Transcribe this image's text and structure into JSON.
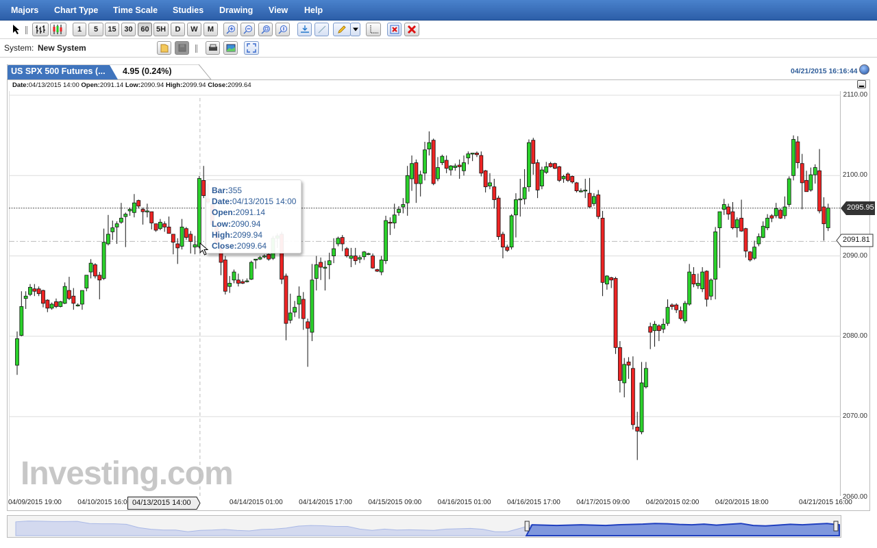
{
  "menu": [
    "Majors",
    "Chart Type",
    "Time Scale",
    "Studies",
    "Drawing",
    "View",
    "Help"
  ],
  "toolbar": {
    "intervals": [
      "1",
      "5",
      "15",
      "30",
      "60",
      "5H",
      "D",
      "W",
      "M"
    ],
    "active_interval": "60"
  },
  "system": {
    "label": "System:",
    "name": "New System"
  },
  "instrument": {
    "tab_label": "US SPX 500 Futures (...",
    "change": "4.95 (0.24%)",
    "timestamp": "04/21/2015 16:16:44"
  },
  "info_line": {
    "date_label": "Date:",
    "date": "04/13/2015 14:00",
    "open_label": "Open:",
    "open": "2091.14",
    "low_label": "Low:",
    "low": "2090.94",
    "high_label": "High:",
    "high": "2099.94",
    "close_label": "Close:",
    "close": "2099.64"
  },
  "tooltip": {
    "bar_label": "Bar:",
    "bar": "355",
    "date_label": "Date:",
    "date": "04/13/2015 14:00",
    "open_label": "Open:",
    "open": "2091.14",
    "low_label": "Low:",
    "low": "2090.94",
    "high_label": "High:",
    "high": "2099.94",
    "close_label": "Close:",
    "close": "2099.64"
  },
  "crosshair_label": "04/13/2015 14:00",
  "watermark": "Investing.com",
  "colors": {
    "up": "#2bd12b",
    "down": "#ee2424",
    "menu": "#2c5ea8",
    "accent": "#2f5d99"
  },
  "chart_data": {
    "type": "candlestick",
    "title": "US SPX 500 Futures",
    "ylim": [
      2060,
      2110
    ],
    "y_ticks": [
      "2110.00",
      "2100.00",
      "2090.00",
      "2080.00",
      "2070.00",
      "2060.00"
    ],
    "y_tick_values": [
      2110,
      2100,
      2090,
      2080,
      2070,
      2060
    ],
    "x_ticks": [
      "04/09/2015 19:00",
      "04/10/2015 16:00",
      "04/14/2015 01:00",
      "04/14/2015 17:00",
      "04/15/2015 09:00",
      "04/16/2015 01:00",
      "04/16/2015 17:00",
      "04/17/2015 09:00",
      "04/20/2015 02:00",
      "04/20/2015 18:00",
      "04/21/2015 16:00"
    ],
    "x_tick_bar_index": [
      0,
      16,
      51,
      67,
      83,
      99,
      115,
      131,
      147,
      163,
      188
    ],
    "last_price": {
      "value": 2095.95,
      "label": "2095.95"
    },
    "ref_price": {
      "value": 2091.81,
      "label": "2091.81"
    },
    "crosshair_bar_index": 42,
    "ohlc": [
      [
        2076.4,
        2080.6,
        2075.2,
        2079.7
      ],
      [
        2080.1,
        2085.6,
        2080.0,
        2083.7
      ],
      [
        2084.7,
        2085.6,
        2083.4,
        2085.0
      ],
      [
        2085.2,
        2086.5,
        2085.0,
        2086.1
      ],
      [
        2085.9,
        2086.5,
        2085.0,
        2085.6
      ],
      [
        2085.9,
        2086.2,
        2085.0,
        2085.3
      ],
      [
        2085.7,
        2085.8,
        2083.6,
        2084.1
      ],
      [
        2084.5,
        2084.6,
        2083.0,
        2083.5
      ],
      [
        2083.5,
        2084.2,
        2083.3,
        2084.0
      ],
      [
        2084.3,
        2084.7,
        2083.5,
        2083.7
      ],
      [
        2083.7,
        2084.4,
        2083.6,
        2084.3
      ],
      [
        2084.1,
        2086.7,
        2084.0,
        2086.2
      ],
      [
        2085.7,
        2087.4,
        2084.5,
        2084.7
      ],
      [
        2085.0,
        2086.0,
        2083.3,
        2084.1
      ],
      [
        2083.9,
        2084.1,
        2083.7,
        2083.9
      ],
      [
        2084.0,
        2085.7,
        2083.3,
        2085.7
      ],
      [
        2086.0,
        2087.6,
        2085.6,
        2087.6
      ],
      [
        2088.0,
        2089.6,
        2087.2,
        2089.1
      ],
      [
        2088.9,
        2089.1,
        2087.2,
        2087.5
      ],
      [
        2087.6,
        2088.0,
        2084.6,
        2087.0
      ],
      [
        2087.2,
        2093.4,
        2087.0,
        2091.7
      ],
      [
        2091.5,
        2095.1,
        2091.3,
        2092.7
      ],
      [
        2093.0,
        2094.4,
        2092.0,
        2093.5
      ],
      [
        2093.6,
        2094.3,
        2091.5,
        2094.0
      ],
      [
        2094.2,
        2096.6,
        2094.0,
        2094.7
      ],
      [
        2094.9,
        2095.4,
        2091.1,
        2095.2
      ],
      [
        2095.6,
        2096.0,
        2095.0,
        2095.8
      ],
      [
        2095.4,
        2097.7,
        2094.8,
        2096.6
      ],
      [
        2096.9,
        2097.0,
        2095.9,
        2096.2
      ],
      [
        2095.8,
        2096.0,
        2093.9,
        2095.5
      ],
      [
        2095.5,
        2096.5,
        2094.8,
        2095.6
      ],
      [
        2095.5,
        2095.5,
        2093.3,
        2094.1
      ],
      [
        2094.0,
        2094.0,
        2093.0,
        2093.2
      ],
      [
        2093.4,
        2094.6,
        2093.2,
        2094.2
      ],
      [
        2094.0,
        2094.3,
        2093.0,
        2093.6
      ],
      [
        2093.6,
        2094.9,
        2092.8,
        2092.8
      ],
      [
        2092.7,
        2092.7,
        2090.2,
        2091.7
      ],
      [
        2091.5,
        2092.2,
        2089.0,
        2091.0
      ],
      [
        2091.2,
        2094.6,
        2090.8,
        2093.6
      ],
      [
        2093.4,
        2093.6,
        2092.0,
        2092.3
      ],
      [
        2092.7,
        2093.1,
        2090.3,
        2091.8
      ],
      [
        2091.1,
        2092.5,
        2090.2,
        2091.4
      ],
      [
        2091.14,
        2099.94,
        2090.94,
        2099.64
      ],
      [
        2099.4,
        2101.2,
        2097.2,
        2097.5
      ],
      [
        2097.1,
        2099.0,
        2096.5,
        2096.7
      ],
      [
        2096.4,
        2096.8,
        2092.9,
        2093.9
      ],
      [
        2093.9,
        2094.2,
        2091.2,
        2091.5
      ],
      [
        2091.2,
        2092.0,
        2087.6,
        2089.2
      ],
      [
        2089.5,
        2090.0,
        2085.2,
        2085.6
      ],
      [
        2086.2,
        2087.5,
        2085.4,
        2086.6
      ],
      [
        2087.0,
        2088.3,
        2086.6,
        2088.0
      ],
      [
        2087.0,
        2087.8,
        2086.2,
        2086.6
      ],
      [
        2086.8,
        2087.1,
        2086.5,
        2086.6
      ],
      [
        2086.9,
        2087.2,
        2086.7,
        2086.9
      ],
      [
        2087.1,
        2089.4,
        2087.0,
        2089.2
      ],
      [
        2089.5,
        2089.6,
        2088.4,
        2089.6
      ],
      [
        2089.6,
        2090.0,
        2089.5,
        2089.8
      ],
      [
        2089.9,
        2090.2,
        2089.7,
        2090.0
      ],
      [
        2090.2,
        2090.3,
        2089.4,
        2089.6
      ],
      [
        2089.7,
        2092.5,
        2089.5,
        2092.2
      ],
      [
        2092.2,
        2092.8,
        2091.0,
        2092.5
      ],
      [
        2092.7,
        2093.0,
        2086.5,
        2087.1
      ],
      [
        2087.5,
        2087.8,
        2079.5,
        2081.6
      ],
      [
        2082.0,
        2085.3,
        2081.6,
        2082.9
      ],
      [
        2083.0,
        2084.4,
        2082.4,
        2083.6
      ],
      [
        2084.0,
        2086.2,
        2082.2,
        2085.0
      ],
      [
        2084.6,
        2085.5,
        2080.8,
        2082.2
      ],
      [
        2081.8,
        2082.2,
        2076.2,
        2081.0
      ],
      [
        2080.5,
        2089.0,
        2079.4,
        2087.0
      ],
      [
        2087.2,
        2090.0,
        2085.7,
        2088.9
      ],
      [
        2089.2,
        2089.8,
        2087.0,
        2088.6
      ],
      [
        2088.6,
        2089.4,
        2085.7,
        2088.6
      ],
      [
        2088.9,
        2090.4,
        2087.1,
        2089.4
      ],
      [
        2090.0,
        2092.2,
        2089.1,
        2090.9
      ],
      [
        2091.5,
        2092.4,
        2091.2,
        2092.2
      ],
      [
        2092.3,
        2092.6,
        2090.6,
        2091.5
      ],
      [
        2090.9,
        2091.1,
        2089.8,
        2090.0
      ],
      [
        2089.7,
        2091.0,
        2088.6,
        2090.0
      ],
      [
        2090.0,
        2091.0,
        2088.9,
        2089.4
      ],
      [
        2089.6,
        2090.1,
        2089.1,
        2089.8
      ],
      [
        2089.9,
        2090.6,
        2089.5,
        2090.5
      ],
      [
        2090.3,
        2090.4,
        2090.1,
        2090.3
      ],
      [
        2090.0,
        2090.3,
        2088.4,
        2088.5
      ],
      [
        2088.3,
        2088.4,
        2088.0,
        2088.1
      ],
      [
        2088.0,
        2090.0,
        2087.6,
        2089.5
      ],
      [
        2089.4,
        2095.0,
        2089.0,
        2094.4
      ],
      [
        2094.2,
        2094.8,
        2092.6,
        2094.1
      ],
      [
        2094.1,
        2096.5,
        2093.4,
        2095.1
      ],
      [
        2095.4,
        2096.2,
        2095.0,
        2095.8
      ],
      [
        2096.1,
        2097.2,
        2095.3,
        2096.4
      ],
      [
        2096.6,
        2101.2,
        2095.0,
        2100.0
      ],
      [
        2099.6,
        2102.5,
        2098.1,
        2101.5
      ],
      [
        2101.6,
        2102.0,
        2096.6,
        2099.0
      ],
      [
        2099.0,
        2100.6,
        2097.4,
        2100.1
      ],
      [
        2100.3,
        2104.2,
        2099.4,
        2103.2
      ],
      [
        2103.3,
        2105.5,
        2102.5,
        2104.1
      ],
      [
        2104.4,
        2104.6,
        2098.8,
        2099.0
      ],
      [
        2099.6,
        2102.3,
        2099.3,
        2101.0
      ],
      [
        2101.6,
        2102.6,
        2101.3,
        2102.4
      ],
      [
        2101.9,
        2102.5,
        2100.3,
        2100.9
      ],
      [
        2100.7,
        2101.3,
        2100.0,
        2101.2
      ],
      [
        2101.0,
        2101.5,
        2100.6,
        2101.2
      ],
      [
        2101.3,
        2102.0,
        2099.6,
        2101.1
      ],
      [
        2100.6,
        2102.5,
        2100.0,
        2101.6
      ],
      [
        2102.2,
        2103.0,
        2101.4,
        2102.7
      ],
      [
        2102.8,
        2102.8,
        2101.8,
        2102.8
      ],
      [
        2102.8,
        2103.0,
        2102.3,
        2102.6
      ],
      [
        2102.5,
        2103.0,
        2099.9,
        2100.3
      ],
      [
        2100.6,
        2100.7,
        2097.9,
        2098.6
      ],
      [
        2098.7,
        2100.3,
        2098.3,
        2099.1
      ],
      [
        2098.6,
        2099.6,
        2095.9,
        2097.0
      ],
      [
        2097.2,
        2097.5,
        2092.0,
        2092.4
      ],
      [
        2092.7,
        2093.0,
        2089.7,
        2091.1
      ],
      [
        2091.1,
        2091.4,
        2090.5,
        2090.7
      ],
      [
        2091.1,
        2095.2,
        2090.8,
        2095.0
      ],
      [
        2095.1,
        2097.8,
        2092.3,
        2097.0
      ],
      [
        2097.1,
        2099.6,
        2094.9,
        2097.1
      ],
      [
        2097.1,
        2100.8,
        2096.4,
        2098.5
      ],
      [
        2098.6,
        2104.5,
        2098.0,
        2104.1
      ],
      [
        2104.4,
        2104.7,
        2100.1,
        2101.5
      ],
      [
        2101.6,
        2102.0,
        2097.2,
        2098.2
      ],
      [
        2098.7,
        2101.1,
        2098.3,
        2100.7
      ],
      [
        2100.4,
        2101.7,
        2100.2,
        2101.1
      ],
      [
        2101.5,
        2101.7,
        2101.0,
        2101.1
      ],
      [
        2101.5,
        2101.6,
        2100.8,
        2100.9
      ],
      [
        2101.1,
        2101.2,
        2099.2,
        2099.4
      ],
      [
        2099.6,
        2100.1,
        2099.1,
        2099.9
      ],
      [
        2100.2,
        2100.4,
        2099.2,
        2099.4
      ],
      [
        2099.9,
        2100.0,
        2099.0,
        2099.2
      ],
      [
        2099.1,
        2099.2,
        2097.9,
        2098.1
      ],
      [
        2098.1,
        2098.4,
        2097.9,
        2098.1
      ],
      [
        2098.2,
        2099.6,
        2097.2,
        2098.2
      ],
      [
        2097.8,
        2099.7,
        2096.0,
        2096.1
      ],
      [
        2096.5,
        2097.8,
        2096.2,
        2097.4
      ],
      [
        2097.6,
        2098.2,
        2094.6,
        2094.9
      ],
      [
        2094.7,
        2095.6,
        2085.0,
        2086.7
      ],
      [
        2086.5,
        2087.6,
        2085.8,
        2087.5
      ],
      [
        2087.3,
        2087.4,
        2086.0,
        2087.0
      ],
      [
        2087.2,
        2087.4,
        2077.8,
        2078.6
      ],
      [
        2078.6,
        2079.4,
        2073.0,
        2074.5
      ],
      [
        2074.2,
        2077.3,
        2072.4,
        2076.5
      ],
      [
        2076.8,
        2077.4,
        2074.7,
        2076.4
      ],
      [
        2076.0,
        2077.5,
        2068.4,
        2069.0
      ],
      [
        2068.7,
        2070.6,
        2064.6,
        2068.2
      ],
      [
        2068.1,
        2076.8,
        2067.8,
        2074.2
      ],
      [
        2073.7,
        2076.8,
        2073.5,
        2076.0
      ],
      [
        2081.2,
        2081.7,
        2078.4,
        2080.5
      ],
      [
        2080.7,
        2081.9,
        2078.7,
        2081.5
      ],
      [
        2081.3,
        2081.5,
        2079.4,
        2080.7
      ],
      [
        2080.9,
        2082.2,
        2080.4,
        2081.5
      ],
      [
        2081.6,
        2084.6,
        2081.3,
        2083.6
      ],
      [
        2083.9,
        2084.1,
        2083.3,
        2083.7
      ],
      [
        2083.9,
        2084.1,
        2082.9,
        2083.3
      ],
      [
        2083.2,
        2083.7,
        2082.0,
        2082.2
      ],
      [
        2081.9,
        2084.4,
        2081.6,
        2084.1
      ],
      [
        2084.0,
        2089.0,
        2083.8,
        2088.0
      ],
      [
        2087.7,
        2088.6,
        2086.1,
        2086.5
      ],
      [
        2086.3,
        2087.8,
        2085.9,
        2086.6
      ],
      [
        2085.9,
        2088.6,
        2085.5,
        2088.0
      ],
      [
        2088.1,
        2088.2,
        2083.7,
        2084.6
      ],
      [
        2085.0,
        2087.2,
        2084.5,
        2087.0
      ],
      [
        2087.1,
        2093.6,
        2084.6,
        2093.0
      ],
      [
        2093.5,
        2095.5,
        2088.5,
        2095.5
      ],
      [
        2095.8,
        2097.1,
        2095.1,
        2096.4
      ],
      [
        2096.1,
        2096.5,
        2094.5,
        2095.2
      ],
      [
        2095.5,
        2096.7,
        2093.3,
        2093.5
      ],
      [
        2093.5,
        2094.8,
        2092.3,
        2094.5
      ],
      [
        2094.7,
        2097.0,
        2093.0,
        2093.1
      ],
      [
        2093.4,
        2093.5,
        2089.8,
        2090.6
      ],
      [
        2090.5,
        2090.6,
        2089.3,
        2089.5
      ],
      [
        2089.7,
        2091.9,
        2089.5,
        2091.1
      ],
      [
        2091.5,
        2092.8,
        2091.2,
        2092.4
      ],
      [
        2092.3,
        2094.3,
        2092.2,
        2093.7
      ],
      [
        2093.5,
        2095.2,
        2093.2,
        2094.7
      ],
      [
        2095.0,
        2095.2,
        2094.2,
        2094.7
      ],
      [
        2095.0,
        2096.6,
        2094.7,
        2095.9
      ],
      [
        2095.7,
        2095.9,
        2094.6,
        2094.7
      ],
      [
        2095.0,
        2097.4,
        2094.6,
        2096.1
      ],
      [
        2096.4,
        2099.9,
        2096.1,
        2099.6
      ],
      [
        2100.0,
        2105.0,
        2099.4,
        2104.5
      ],
      [
        2104.2,
        2104.9,
        2100.9,
        2101.6
      ],
      [
        2101.5,
        2102.7,
        2095.8,
        2099.1
      ],
      [
        2099.4,
        2100.6,
        2098.0,
        2098.0
      ],
      [
        2098.2,
        2101.0,
        2098.0,
        2100.1
      ],
      [
        2100.1,
        2101.4,
        2099.0,
        2101.0
      ],
      [
        2100.6,
        2103.3,
        2095.3,
        2095.6
      ],
      [
        2096.1,
        2097.3,
        2091.9,
        2094.0
      ],
      [
        2093.5,
        2096.5,
        2093.1,
        2095.95
      ]
    ]
  },
  "navigator": {
    "levels": [
      80,
      85,
      84,
      82,
      82,
      83,
      70,
      68,
      68,
      65,
      45,
      35,
      30,
      30,
      20,
      28,
      30,
      34,
      28,
      25,
      34,
      36,
      42,
      54,
      58,
      56,
      52,
      52,
      36,
      28,
      36,
      30,
      32,
      30,
      28,
      36,
      38,
      40,
      35,
      20,
      20,
      40,
      62,
      60,
      58,
      60,
      62,
      60,
      58,
      62,
      64,
      66,
      70,
      68,
      64,
      62,
      66,
      60,
      65,
      70,
      58,
      55,
      60,
      65,
      62,
      66,
      70,
      62
    ],
    "selection_start": 0.62,
    "selection_end": 1.0
  }
}
